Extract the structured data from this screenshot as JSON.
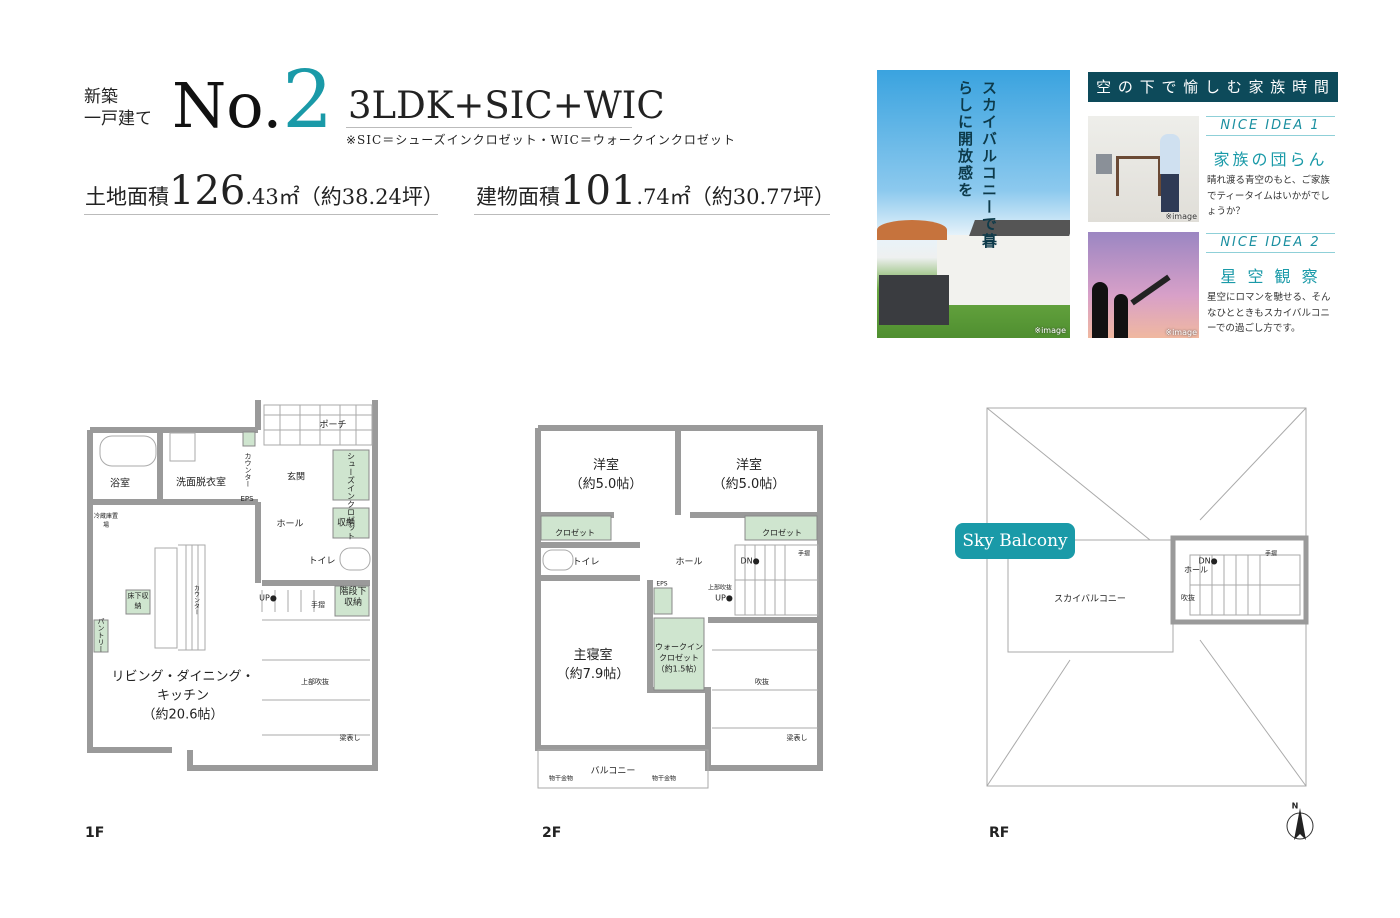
{
  "header": {
    "kind_line1": "新築",
    "kind_line2": "一戸建て",
    "no_label": "No.",
    "no_number": "2",
    "plan": "3LDK+SIC+WIC",
    "plan_note": "※SIC＝シューズインクロゼット・WIC＝ウォークインクロゼット",
    "land_label": "土地面積",
    "land_int": "126",
    "land_dec": ".43㎡",
    "land_tsubo": "（約38.24坪）",
    "bldg_label": "建物面積",
    "bldg_int": "101",
    "bldg_dec": ".74㎡",
    "bldg_tsubo": "（約30.77坪）"
  },
  "promo": {
    "photo_caption": "スカイバルコニーで暮らしに開放感を",
    "image_note": "※image",
    "banner": "空 の 下 で 愉 し む 家 族 時 間",
    "ideas": [
      {
        "tag": "NICE IDEA 1",
        "title": "家族の団らん",
        "desc": "晴れ渡る青空のもと、ご家族でティータイムはいかがでしょうか？",
        "image_note": "※image"
      },
      {
        "tag": "NICE IDEA 2",
        "title": "星 空 観 察",
        "desc": "星空にロマンを馳せる、そんなひとときもスカイバルコニーでの過ごし方です。",
        "image_note": "※image"
      }
    ]
  },
  "colors": {
    "accent": "#1a9aa8",
    "banner": "#0d4a5a",
    "storage": "#cfe5cf",
    "wall": "#9a9a9a"
  },
  "floor1": {
    "name": "1F",
    "bath": "浴室",
    "washroom": "洗面脱衣室",
    "counter1": "カウンター",
    "eps": "EPS",
    "porch": "ポーチ",
    "entrance": "玄関",
    "shoes": "シューズインクロゼット",
    "hall": "ホール",
    "storage": "収納",
    "toilet": "トイレ",
    "up": "UP●",
    "handrail": "手摺",
    "understair": "階段下収納",
    "fridge": "冷蔵庫置場",
    "underfloor": "床下収納",
    "counter2": "カウンター",
    "pantry": "パントリー",
    "ldk1": "リビング・ダイニング・",
    "ldk2": "キッチン",
    "ldk3": "（約20.6帖）",
    "void": "上部吹抜",
    "beam": "梁表し"
  },
  "floor2": {
    "name": "2F",
    "room1": "洋室",
    "room1_size": "（約5.0帖）",
    "room2": "洋室",
    "room2_size": "（約5.0帖）",
    "closet1": "クロゼット",
    "closet2": "クロゼット",
    "toilet": "トイレ",
    "hall": "ホール",
    "dn": "DN●",
    "handrail": "手摺",
    "eps": "EPS",
    "void_above": "上部吹抜",
    "up": "UP●",
    "master": "主寝室",
    "master_size": "（約7.9帖）",
    "wic1": "ウォークイン",
    "wic2": "クロゼット",
    "wic3": "（約1.5帖）",
    "void": "吹抜",
    "beam": "梁表し",
    "balcony": "バルコニー",
    "hanger1": "物干金物",
    "hanger2": "物干金物"
  },
  "roof": {
    "name": "RF",
    "badge": "Sky Balcony",
    "skybalcony": "スカイバルコニー",
    "dn": "DN●",
    "hall": "ホール",
    "handrail": "手摺",
    "void": "吹抜",
    "north": "N"
  }
}
